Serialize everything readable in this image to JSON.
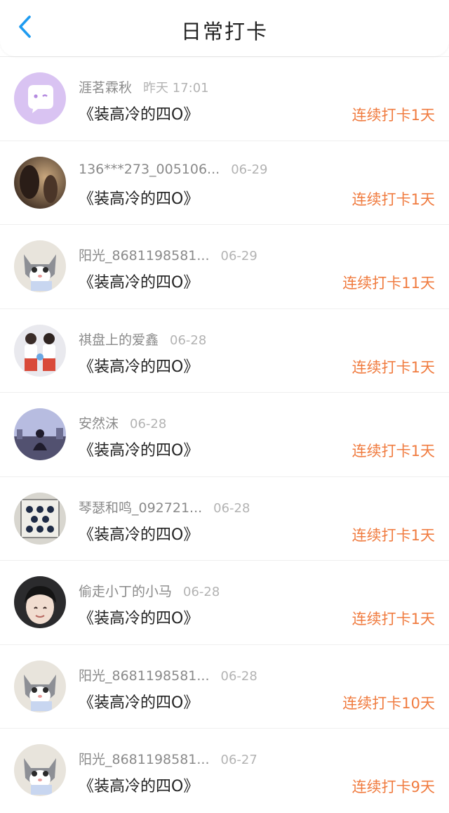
{
  "header": {
    "title": "日常打卡",
    "back_icon": "chevron-left-icon",
    "accent": "#1e9bf0"
  },
  "colors": {
    "streak": "#f07b3f",
    "name": "#8a8a8a",
    "time": "#b3b3b3"
  },
  "items": [
    {
      "name": "涯茗霖秋",
      "time": "昨天 17:01",
      "book": "《装高冷的四O》",
      "streak": "连续打卡1天",
      "avatar": "ghost-emoji-avatar"
    },
    {
      "name": "136***273_005106...",
      "time": "06-29",
      "book": "《装高冷的四O》",
      "streak": "连续打卡1天",
      "avatar": "silhouette-photo-avatar"
    },
    {
      "name": "阳光_8681198581...",
      "time": "06-29",
      "book": "《装高冷的四O》",
      "streak": "连续打卡11天",
      "avatar": "cat-photo-avatar"
    },
    {
      "name": "祺盘上的爱鑫",
      "time": "06-28",
      "book": "《装高冷的四O》",
      "streak": "连续打卡1天",
      "avatar": "two-people-photo-avatar"
    },
    {
      "name": "安然沫",
      "time": "06-28",
      "book": "《装高冷的四O》",
      "streak": "连续打卡1天",
      "avatar": "cityscape-photo-avatar"
    },
    {
      "name": "琴瑟和鸣_092721...",
      "time": "06-28",
      "book": "《装高冷的四O》",
      "streak": "连续打卡1天",
      "avatar": "board-game-photo-avatar"
    },
    {
      "name": "偷走小丁的小马",
      "time": "06-28",
      "book": "《装高冷的四O》",
      "streak": "连续打卡1天",
      "avatar": "person-photo-avatar"
    },
    {
      "name": "阳光_8681198581...",
      "time": "06-28",
      "book": "《装高冷的四O》",
      "streak": "连续打卡10天",
      "avatar": "cat-photo-avatar"
    },
    {
      "name": "阳光_8681198581...",
      "time": "06-27",
      "book": "《装高冷的四O》",
      "streak": "连续打卡9天",
      "avatar": "cat-photo-avatar"
    }
  ]
}
